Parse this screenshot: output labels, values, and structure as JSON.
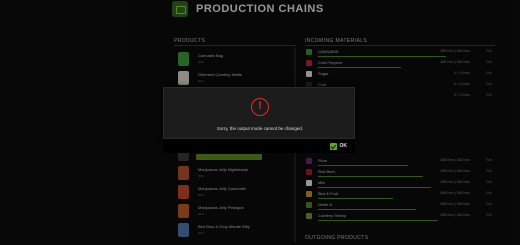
{
  "header": {
    "title": "PRODUCTION CHAINS"
  },
  "products": {
    "heading": "PRODUCTS",
    "items": [
      {
        "name": "Cannabis Bag",
        "sub": "50%",
        "color": "#3d9a3a"
      },
      {
        "name": "Ointment Comfrey Nettle",
        "sub": "50%",
        "color": "#d8d8c8"
      },
      {
        "name": "",
        "sub": "",
        "color": "#3a3a3a"
      },
      {
        "name": "",
        "sub": "",
        "color": "#3a3a3a"
      },
      {
        "name": "",
        "sub": "",
        "color": "#3a3a3a"
      },
      {
        "name": "",
        "sub": "",
        "color": "#3a3a3a"
      },
      {
        "name": "Marijuanas Jelly Nightshade",
        "sub": "50%",
        "color": "#b2502e"
      },
      {
        "name": "Marijuanas Jelly Camomile",
        "sub": "50%",
        "color": "#c2472a"
      },
      {
        "name": "Marijuanas Jelly Pelargon",
        "sub": "50%",
        "color": "#bc5a2c"
      },
      {
        "name": "Bird Blue & Drop Mitrate Billy",
        "sub": "50%",
        "color": "#4a7ab0"
      }
    ]
  },
  "incoming": {
    "heading": "INCOMING MATERIALS",
    "items": [
      {
        "name": "CANNABIS",
        "value": "468 l/mo | 184 l/mo",
        "mode": "Sell",
        "color": "#3f8f2a"
      },
      {
        "name": "Cold Peppers",
        "value": "468 l/mo | 184 l/mo",
        "mode": "Sell",
        "color": "#b8282a"
      },
      {
        "name": "Sugar",
        "value": "0 l | 0 l/mo",
        "mode": "Sell",
        "color": "#e0e0e0"
      },
      {
        "name": "Coal",
        "value": "0 l | 0 l/mo",
        "mode": "Sell",
        "color": "#2a2a2a"
      },
      {
        "name": "Wool",
        "value": "0 l | 0 l/mo",
        "mode": "Sell",
        "color": "#d6cfb8"
      },
      {
        "name": "Plum",
        "value": "468 l/mo | 184 l/mo",
        "mode": "Sell",
        "color": "#6b2a78"
      },
      {
        "name": "Red Beet",
        "value": "468 l/mo | 184 l/mo",
        "mode": "Sell",
        "color": "#9c1c3a"
      },
      {
        "name": "Milk",
        "value": "468 l/mo | 184 l/mo",
        "mode": "Sell",
        "color": "#e8e8e8"
      },
      {
        "name": "Bird & Fruit",
        "value": "468 l/mo | 184 l/mo",
        "mode": "Sell",
        "color": "#c8962a"
      },
      {
        "name": "Nettle &",
        "value": "468 l/mo | 184 l/mo",
        "mode": "Sell",
        "color": "#4f8a2a"
      },
      {
        "name": "Comfrey Sheep",
        "value": "468 l/mo | 184 l/mo",
        "mode": "Sell",
        "color": "#6a9a3a"
      }
    ],
    "progress": [
      0.85,
      0.55,
      0,
      0,
      0,
      0.6,
      0.7,
      0.75,
      0.5,
      0.65,
      0.8
    ]
  },
  "outgoing": {
    "heading": "OUTGOING PRODUCTS"
  },
  "dialog": {
    "icon_glyph": "!",
    "message": "Sorry, the output mode cannot be changed.",
    "ok_label": "OK"
  }
}
